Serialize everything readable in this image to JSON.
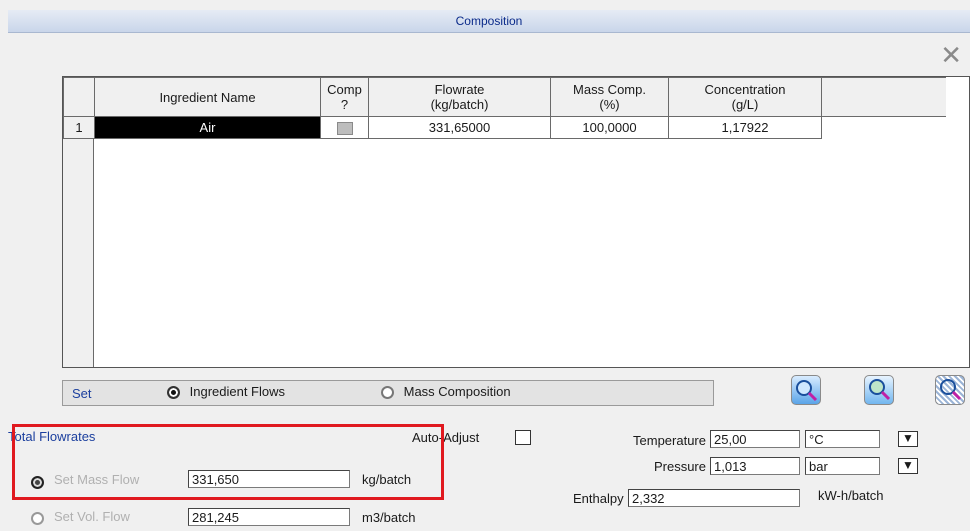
{
  "window": {
    "title": "Composition"
  },
  "grid": {
    "headers": [
      "Ingredient Name",
      "Comp\n?",
      "Flowrate\n(kg/batch)",
      "Mass Comp.\n(%)",
      "Concentration\n(g/L)"
    ],
    "rows": [
      {
        "num": "1",
        "name": "Air",
        "comp_checked": false,
        "flowrate": "331,65000",
        "mass_comp": "100,0000",
        "concentration": "1,17922"
      }
    ]
  },
  "setbar": {
    "label": "Set",
    "option_ingredient": "Ingredient Flows",
    "option_mass": "Mass Composition",
    "selected": "Ingredient Flows"
  },
  "total": {
    "title": "Total Flowrates",
    "auto_adjust_label": "Auto-Adjust",
    "mass_label": "Set Mass Flow",
    "mass_value": "331,650",
    "mass_unit": "kg/batch",
    "vol_label": "Set Vol. Flow",
    "vol_value": "281,245",
    "vol_unit": "m3/batch"
  },
  "conditions": {
    "temperature_label": "Temperature",
    "temperature_value": "25,00",
    "temperature_unit": "°C",
    "pressure_label": "Pressure",
    "pressure_value": "1,013",
    "pressure_unit": "bar",
    "enthalpy_label": "Enthalpy",
    "enthalpy_value": "2,332",
    "enthalpy_unit": "kW-h/batch"
  },
  "icons": [
    "close-icon",
    "zoom-icon",
    "zoom-in-icon",
    "zoom-pattern-icon",
    "down-arrow-icon"
  ]
}
